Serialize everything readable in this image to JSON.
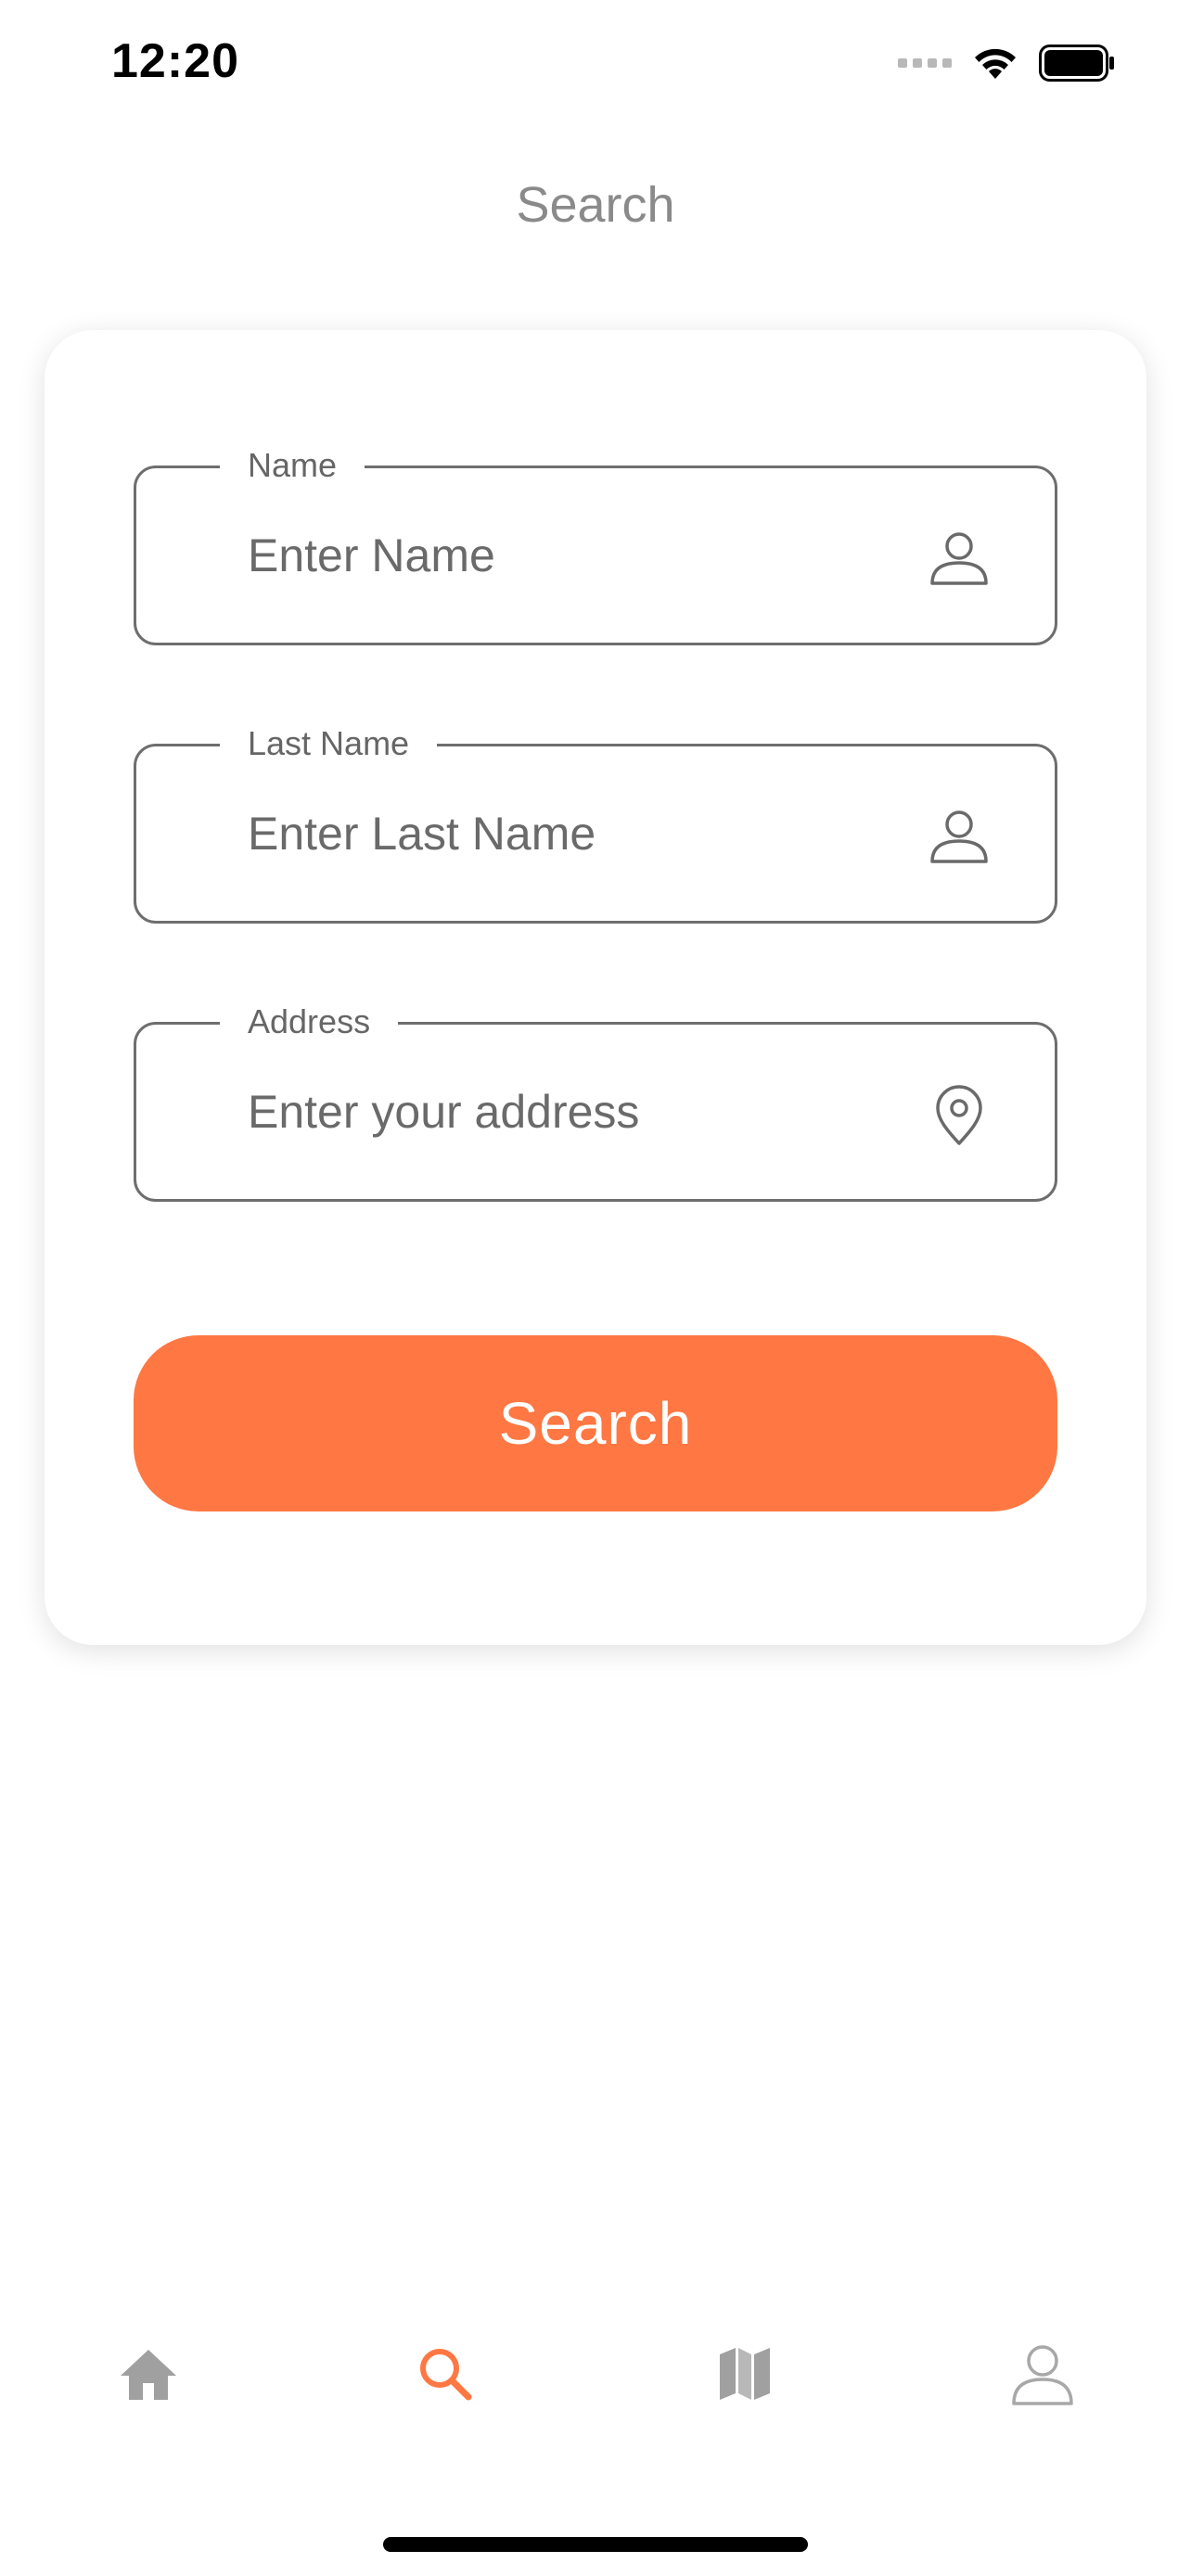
{
  "status_bar": {
    "time": "12:20"
  },
  "header": {
    "title": "Search"
  },
  "form": {
    "name": {
      "label": "Name",
      "placeholder": "Enter Name",
      "value": "",
      "icon": "user-icon"
    },
    "last_name": {
      "label": "Last Name",
      "placeholder": "Enter Last Name",
      "value": "",
      "icon": "user-icon"
    },
    "address": {
      "label": "Address",
      "placeholder": "Enter your address",
      "value": "",
      "icon": "location-pin-icon"
    },
    "submit_label": "Search"
  },
  "tab_bar": {
    "tabs": [
      {
        "icon": "home-icon",
        "active": false
      },
      {
        "icon": "search-icon",
        "active": true
      },
      {
        "icon": "map-icon",
        "active": false
      },
      {
        "icon": "profile-icon",
        "active": false
      }
    ]
  },
  "colors": {
    "accent": "#ff7742",
    "inactive_icon": "#a0a0a0",
    "border": "#6e6e6e",
    "title": "#8a8a8a"
  }
}
